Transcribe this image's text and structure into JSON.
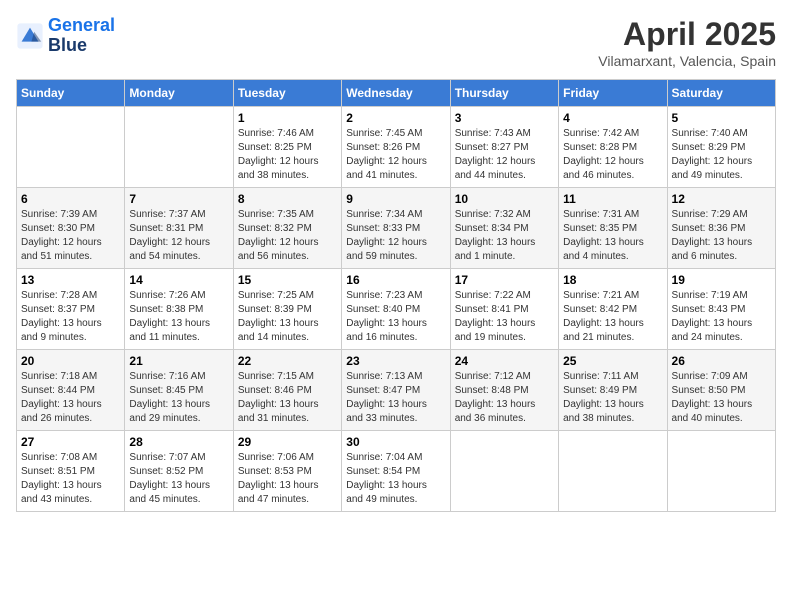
{
  "logo": {
    "line1": "General",
    "line2": "Blue"
  },
  "title": "April 2025",
  "subtitle": "Vilamarxant, Valencia, Spain",
  "weekdays": [
    "Sunday",
    "Monday",
    "Tuesday",
    "Wednesday",
    "Thursday",
    "Friday",
    "Saturday"
  ],
  "weeks": [
    [
      {
        "day": "",
        "sunrise": "",
        "sunset": "",
        "daylight": ""
      },
      {
        "day": "",
        "sunrise": "",
        "sunset": "",
        "daylight": ""
      },
      {
        "day": "1",
        "sunrise": "Sunrise: 7:46 AM",
        "sunset": "Sunset: 8:25 PM",
        "daylight": "Daylight: 12 hours and 38 minutes."
      },
      {
        "day": "2",
        "sunrise": "Sunrise: 7:45 AM",
        "sunset": "Sunset: 8:26 PM",
        "daylight": "Daylight: 12 hours and 41 minutes."
      },
      {
        "day": "3",
        "sunrise": "Sunrise: 7:43 AM",
        "sunset": "Sunset: 8:27 PM",
        "daylight": "Daylight: 12 hours and 44 minutes."
      },
      {
        "day": "4",
        "sunrise": "Sunrise: 7:42 AM",
        "sunset": "Sunset: 8:28 PM",
        "daylight": "Daylight: 12 hours and 46 minutes."
      },
      {
        "day": "5",
        "sunrise": "Sunrise: 7:40 AM",
        "sunset": "Sunset: 8:29 PM",
        "daylight": "Daylight: 12 hours and 49 minutes."
      }
    ],
    [
      {
        "day": "6",
        "sunrise": "Sunrise: 7:39 AM",
        "sunset": "Sunset: 8:30 PM",
        "daylight": "Daylight: 12 hours and 51 minutes."
      },
      {
        "day": "7",
        "sunrise": "Sunrise: 7:37 AM",
        "sunset": "Sunset: 8:31 PM",
        "daylight": "Daylight: 12 hours and 54 minutes."
      },
      {
        "day": "8",
        "sunrise": "Sunrise: 7:35 AM",
        "sunset": "Sunset: 8:32 PM",
        "daylight": "Daylight: 12 hours and 56 minutes."
      },
      {
        "day": "9",
        "sunrise": "Sunrise: 7:34 AM",
        "sunset": "Sunset: 8:33 PM",
        "daylight": "Daylight: 12 hours and 59 minutes."
      },
      {
        "day": "10",
        "sunrise": "Sunrise: 7:32 AM",
        "sunset": "Sunset: 8:34 PM",
        "daylight": "Daylight: 13 hours and 1 minute."
      },
      {
        "day": "11",
        "sunrise": "Sunrise: 7:31 AM",
        "sunset": "Sunset: 8:35 PM",
        "daylight": "Daylight: 13 hours and 4 minutes."
      },
      {
        "day": "12",
        "sunrise": "Sunrise: 7:29 AM",
        "sunset": "Sunset: 8:36 PM",
        "daylight": "Daylight: 13 hours and 6 minutes."
      }
    ],
    [
      {
        "day": "13",
        "sunrise": "Sunrise: 7:28 AM",
        "sunset": "Sunset: 8:37 PM",
        "daylight": "Daylight: 13 hours and 9 minutes."
      },
      {
        "day": "14",
        "sunrise": "Sunrise: 7:26 AM",
        "sunset": "Sunset: 8:38 PM",
        "daylight": "Daylight: 13 hours and 11 minutes."
      },
      {
        "day": "15",
        "sunrise": "Sunrise: 7:25 AM",
        "sunset": "Sunset: 8:39 PM",
        "daylight": "Daylight: 13 hours and 14 minutes."
      },
      {
        "day": "16",
        "sunrise": "Sunrise: 7:23 AM",
        "sunset": "Sunset: 8:40 PM",
        "daylight": "Daylight: 13 hours and 16 minutes."
      },
      {
        "day": "17",
        "sunrise": "Sunrise: 7:22 AM",
        "sunset": "Sunset: 8:41 PM",
        "daylight": "Daylight: 13 hours and 19 minutes."
      },
      {
        "day": "18",
        "sunrise": "Sunrise: 7:21 AM",
        "sunset": "Sunset: 8:42 PM",
        "daylight": "Daylight: 13 hours and 21 minutes."
      },
      {
        "day": "19",
        "sunrise": "Sunrise: 7:19 AM",
        "sunset": "Sunset: 8:43 PM",
        "daylight": "Daylight: 13 hours and 24 minutes."
      }
    ],
    [
      {
        "day": "20",
        "sunrise": "Sunrise: 7:18 AM",
        "sunset": "Sunset: 8:44 PM",
        "daylight": "Daylight: 13 hours and 26 minutes."
      },
      {
        "day": "21",
        "sunrise": "Sunrise: 7:16 AM",
        "sunset": "Sunset: 8:45 PM",
        "daylight": "Daylight: 13 hours and 29 minutes."
      },
      {
        "day": "22",
        "sunrise": "Sunrise: 7:15 AM",
        "sunset": "Sunset: 8:46 PM",
        "daylight": "Daylight: 13 hours and 31 minutes."
      },
      {
        "day": "23",
        "sunrise": "Sunrise: 7:13 AM",
        "sunset": "Sunset: 8:47 PM",
        "daylight": "Daylight: 13 hours and 33 minutes."
      },
      {
        "day": "24",
        "sunrise": "Sunrise: 7:12 AM",
        "sunset": "Sunset: 8:48 PM",
        "daylight": "Daylight: 13 hours and 36 minutes."
      },
      {
        "day": "25",
        "sunrise": "Sunrise: 7:11 AM",
        "sunset": "Sunset: 8:49 PM",
        "daylight": "Daylight: 13 hours and 38 minutes."
      },
      {
        "day": "26",
        "sunrise": "Sunrise: 7:09 AM",
        "sunset": "Sunset: 8:50 PM",
        "daylight": "Daylight: 13 hours and 40 minutes."
      }
    ],
    [
      {
        "day": "27",
        "sunrise": "Sunrise: 7:08 AM",
        "sunset": "Sunset: 8:51 PM",
        "daylight": "Daylight: 13 hours and 43 minutes."
      },
      {
        "day": "28",
        "sunrise": "Sunrise: 7:07 AM",
        "sunset": "Sunset: 8:52 PM",
        "daylight": "Daylight: 13 hours and 45 minutes."
      },
      {
        "day": "29",
        "sunrise": "Sunrise: 7:06 AM",
        "sunset": "Sunset: 8:53 PM",
        "daylight": "Daylight: 13 hours and 47 minutes."
      },
      {
        "day": "30",
        "sunrise": "Sunrise: 7:04 AM",
        "sunset": "Sunset: 8:54 PM",
        "daylight": "Daylight: 13 hours and 49 minutes."
      },
      {
        "day": "",
        "sunrise": "",
        "sunset": "",
        "daylight": ""
      },
      {
        "day": "",
        "sunrise": "",
        "sunset": "",
        "daylight": ""
      },
      {
        "day": "",
        "sunrise": "",
        "sunset": "",
        "daylight": ""
      }
    ]
  ]
}
